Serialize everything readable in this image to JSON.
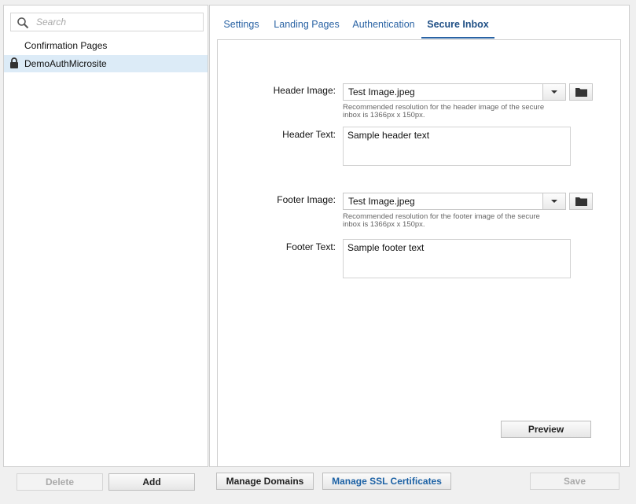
{
  "sidebar": {
    "search_placeholder": "Search",
    "items": [
      {
        "label": "Confirmation Pages",
        "locked": false
      },
      {
        "label": "DemoAuthMicrosite",
        "locked": true
      }
    ],
    "delete_label": "Delete",
    "add_label": "Add"
  },
  "tabs": [
    {
      "label": "Settings"
    },
    {
      "label": "Landing Pages"
    },
    {
      "label": "Authentication"
    },
    {
      "label": "Secure Inbox",
      "active": true
    }
  ],
  "form": {
    "header_image_label": "Header Image:",
    "header_image_value": "Test Image.jpeg",
    "header_hint": "Recommended resolution for the header image of the secure inbox is 1366px x 150px.",
    "header_text_label": "Header Text:",
    "header_text_value": "Sample header text",
    "footer_image_label": "Footer Image:",
    "footer_image_value": "Test Image.jpeg",
    "footer_hint": "Recommended resolution for the footer image of the secure inbox is 1366px x 150px.",
    "footer_text_label": "Footer Text:",
    "footer_text_value": "Sample footer text",
    "preview_label": "Preview"
  },
  "footer": {
    "manage_domains_label": "Manage Domains",
    "manage_ssl_label": "Manage SSL Certificates",
    "save_label": "Save"
  },
  "colors": {
    "accent": "#2a63a4",
    "selected_row": "#dcebf7"
  }
}
